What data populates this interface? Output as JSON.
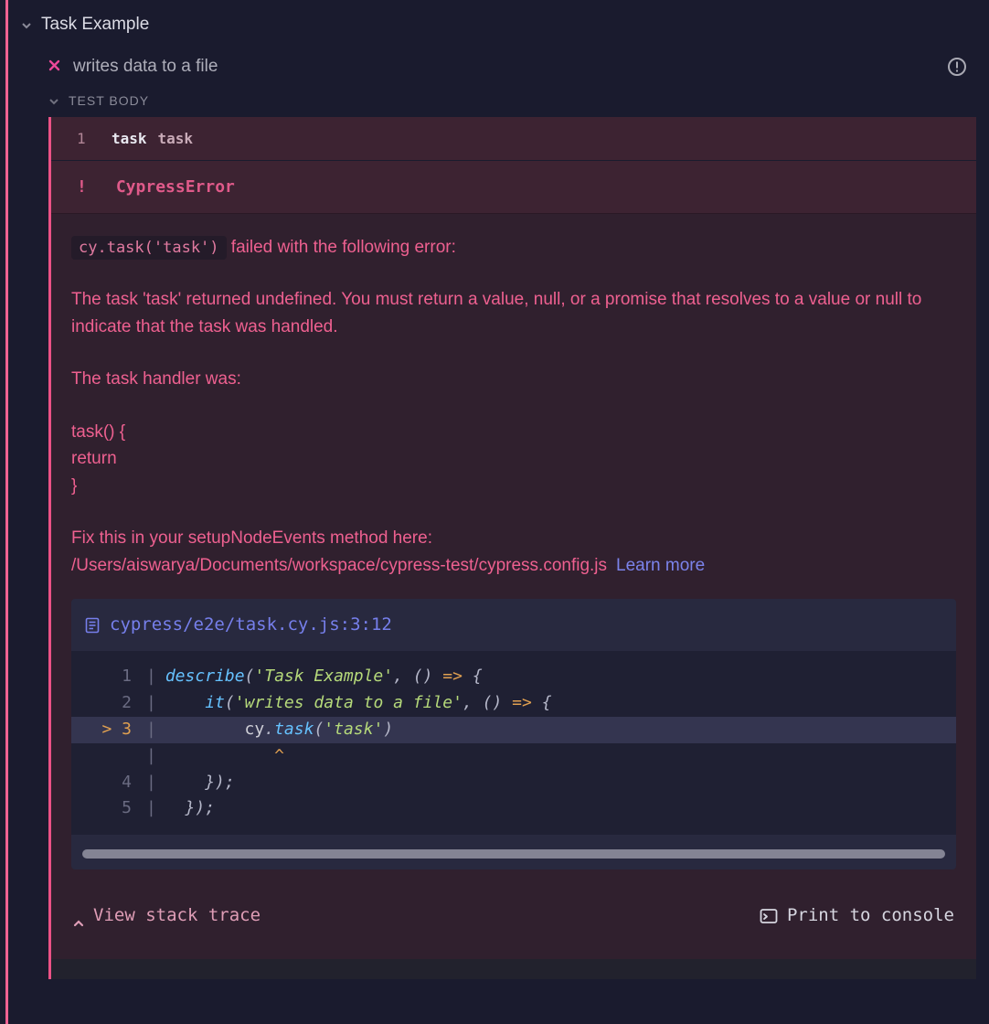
{
  "suite": {
    "title": "Task Example"
  },
  "test": {
    "title": "writes data to a file",
    "body_label": "TEST BODY"
  },
  "command": {
    "num": "1",
    "name": "task",
    "arg": "task"
  },
  "error": {
    "marker": "!",
    "type": "CypressError",
    "code_inline": "cy.task('task')",
    "failed_msg": " failed with the following error:",
    "explain1": "The task 'task' returned undefined. You must return a value, null, or a promise that resolves to a value or null to indicate that the task was handled.",
    "explain2": "The task handler was:",
    "handler_l1": "task() {",
    "handler_l2": "return",
    "handler_l3": "}",
    "fix_msg": "Fix this in your setupNodeEvents method here:",
    "config_path": "/Users/aiswarya/Documents/workspace/cypress-test/cypress.config.js",
    "learn_more": "Learn more"
  },
  "codeframe": {
    "file": "cypress/e2e/task.cy.js:3:12",
    "lines": {
      "l1_gutter": "  1",
      "l2_gutter": "  2",
      "l3_gutter": "> 3",
      "l3b_gutter": "   ",
      "l4_gutter": "  4",
      "l5_gutter": "  5"
    }
  },
  "footer": {
    "view_stack": "View stack trace",
    "print_console": "Print to console"
  }
}
